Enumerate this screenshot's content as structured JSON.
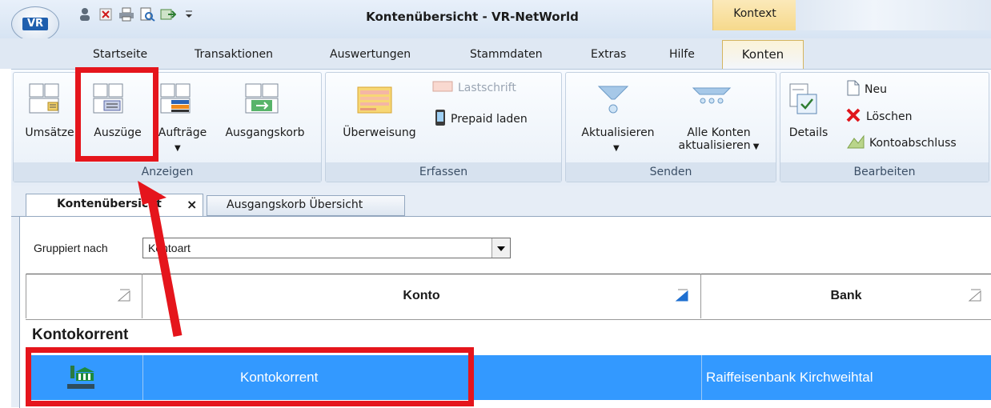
{
  "window": {
    "title": "Kontenübersicht - VR-NetWorld",
    "context_tab": "Kontext",
    "app_logo": "VR"
  },
  "qat": {
    "icons": [
      "user-icon",
      "delete-doc-icon",
      "print-icon",
      "print-preview-icon",
      "export-icon",
      "qat-dropdown-icon"
    ]
  },
  "ribbon_tabs": [
    "Startseite",
    "Transaktionen",
    "Auswertungen",
    "Stammdaten",
    "Extras",
    "Hilfe",
    "Konten"
  ],
  "active_tab": "Konten",
  "groups": {
    "anzeigen": {
      "label": "Anzeigen",
      "buttons": [
        "Umsätze",
        "Auszüge",
        "Aufträge",
        "Ausgangskorb"
      ]
    },
    "erfassen": {
      "label": "Erfassen",
      "ueberweisung": "Überweisung",
      "lastschrift": "Lastschrift",
      "prepaid": "Prepaid laden"
    },
    "senden": {
      "label": "Senden",
      "aktualisieren": "Aktualisieren",
      "alle_konten_1": "Alle Konten",
      "alle_konten_2": "aktualisieren"
    },
    "bearbeiten": {
      "label": "Bearbeiten",
      "details": "Details",
      "neu": "Neu",
      "loeschen": "Löschen",
      "kontoabschluss": "Kontoabschluss"
    }
  },
  "doc_tabs": {
    "active": "Kontenübersicht",
    "second": "Ausgangskorb Übersicht"
  },
  "groupby": {
    "label": "Gruppiert nach",
    "value": "Kontoart"
  },
  "grid": {
    "columns": [
      "",
      "Konto",
      "Bank"
    ],
    "group_title": "Kontokorrent",
    "rows": [
      {
        "konto": "Kontokorrent",
        "bank": "Raiffeisenbank Kirchweihtal"
      }
    ]
  },
  "colors": {
    "selection": "#3399ff",
    "highlight": "#e5151c",
    "accent": "#1f5fae"
  }
}
